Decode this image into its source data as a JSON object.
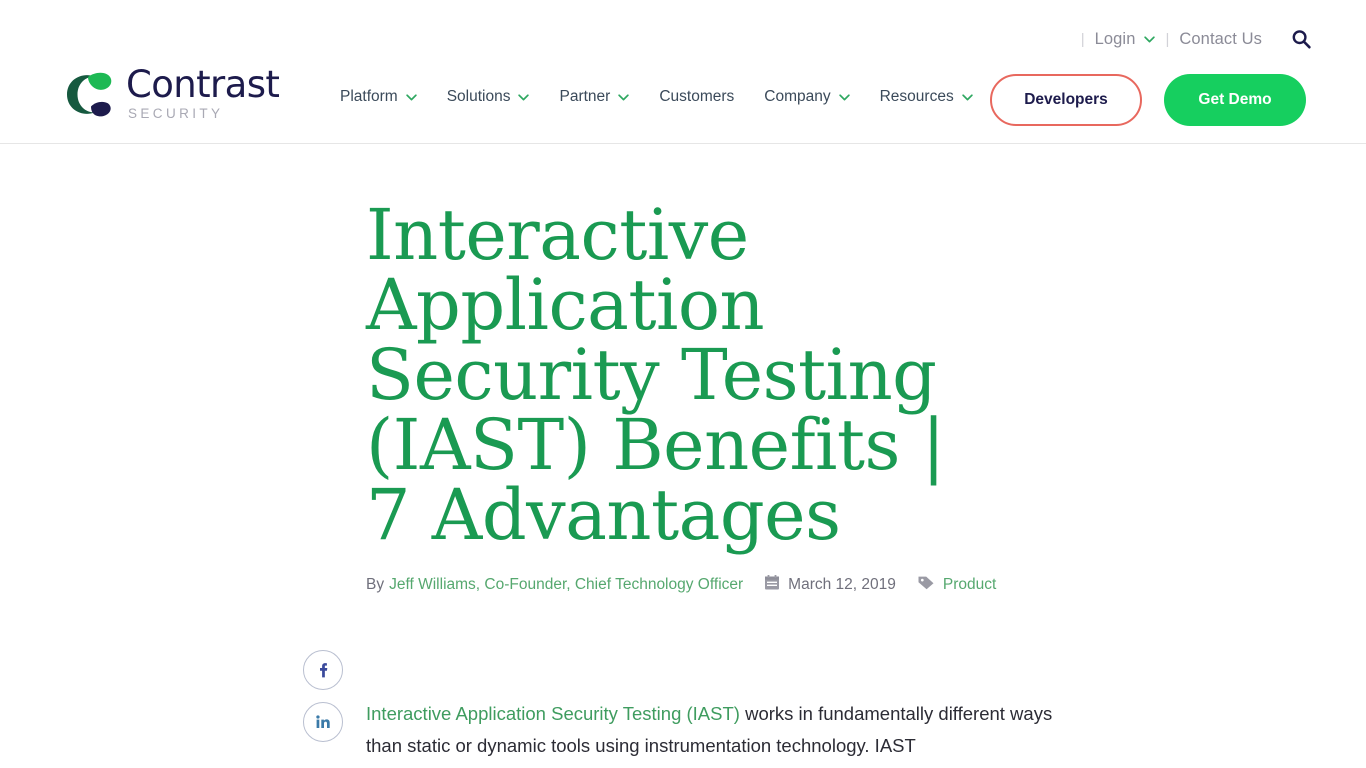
{
  "header": {
    "logo": {
      "word": "Contrast",
      "sub": "SECURITY",
      "mark_green_dark": "#166b4b",
      "mark_green_bright": "#1db954",
      "mark_navy": "#1d1b4c"
    },
    "utility": {
      "separator": "|",
      "login_label": "Login",
      "contact_label": "Contact Us",
      "search_icon": "search-icon",
      "chevron_icon": "chevron-down-icon"
    },
    "nav_items": [
      {
        "label": "Platform",
        "has_dropdown": true
      },
      {
        "label": "Solutions",
        "has_dropdown": true
      },
      {
        "label": "Partner",
        "has_dropdown": true
      },
      {
        "label": "Customers",
        "has_dropdown": false
      },
      {
        "label": "Company",
        "has_dropdown": true
      },
      {
        "label": "Resources",
        "has_dropdown": true
      }
    ],
    "cta": {
      "developers_label": "Developers",
      "developers_border_color": "#e8685e",
      "demo_label": "Get Demo",
      "demo_bg_color": "#16cf5f"
    }
  },
  "article": {
    "title": "Interactive Application Security Testing (IAST) Benefits | 7 Advantages",
    "title_color": "#1a9a52",
    "byline": {
      "prefix": "By",
      "author": "Jeff Williams, Co-Founder, Chief Technology Officer",
      "date_icon": "calendar-icon",
      "date": "March 12, 2019",
      "tag_icon": "tag-icon",
      "tag": "Product"
    },
    "social": [
      {
        "network": "facebook",
        "glyph": "f",
        "color": "#3b4a9c"
      },
      {
        "network": "linkedin",
        "glyph": "in",
        "color": "#3b7aa8"
      }
    ],
    "body": {
      "link_text": "Interactive Application Security Testing (IAST)",
      "link_color": "#3f9c5f",
      "rest": " works in fundamentally different ways than static or dynamic tools using instrumentation technology. IAST"
    }
  }
}
